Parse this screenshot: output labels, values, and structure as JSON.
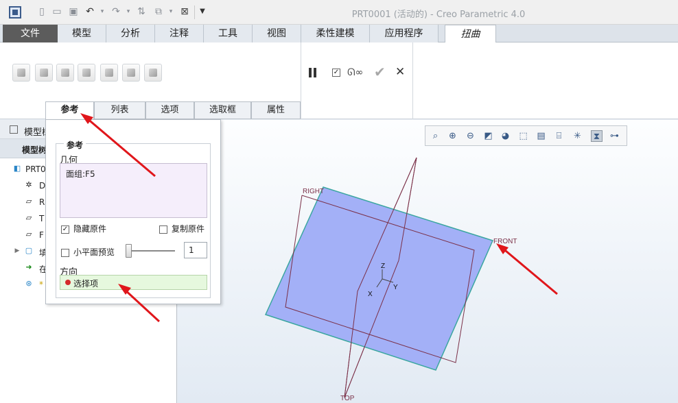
{
  "window": {
    "title": "PRT0001 (活动的) - Creo Parametric 4.0",
    "quick_access": [
      "new-icon",
      "open-icon",
      "save-icon",
      "undo-icon",
      "redo-icon",
      "regenerate-icon",
      "windows-icon",
      "close-window-icon",
      "customize-icon"
    ]
  },
  "ribbon_tabs": [
    "文件",
    "模型",
    "分析",
    "注释",
    "工具",
    "视图",
    "柔性建模",
    "应用程序",
    "扭曲"
  ],
  "toolbar": {
    "tools": [
      "transform-tool",
      "warp-tool",
      "spine-tool",
      "stretch-tool",
      "bend-tool",
      "twist-tool",
      "sculpt-tool"
    ],
    "controls": [
      "pause-icon",
      "preview-checkbox",
      "glasses-icon",
      "ok-icon",
      "cancel-icon"
    ]
  },
  "sub_tabs": [
    "参考",
    "列表",
    "选项",
    "选取框",
    "属性"
  ],
  "reference_panel": {
    "group_title": "参考",
    "geometry_label": "几何",
    "geometry_items": [
      "面组:F5"
    ],
    "hide_original_label": "隐藏原件",
    "hide_original_checked": true,
    "copy_original_label": "复制原件",
    "copy_original_checked": false,
    "small_plane_preview_label": "小平面预览",
    "small_plane_preview_checked": false,
    "preview_value": "1",
    "direction_label": "方向",
    "direction_item": "选择项"
  },
  "model_tree": {
    "header": "模型树",
    "sub_header": "模型树",
    "items": [
      {
        "icon": "part-icon",
        "label": "PRT0"
      },
      {
        "icon": "csys-icon",
        "label": "D"
      },
      {
        "icon": "datum-plane-icon",
        "label": "R"
      },
      {
        "icon": "datum-plane-icon",
        "label": "T"
      },
      {
        "icon": "datum-plane-icon",
        "label": "F"
      },
      {
        "icon": "fill-icon",
        "label": "填"
      },
      {
        "icon": "insert-arrow-icon",
        "label": "在"
      },
      {
        "icon": "warp-feature-icon",
        "label": "*"
      }
    ]
  },
  "graphics": {
    "view_tools": [
      "refit-icon",
      "zoom-in-icon",
      "zoom-out-icon",
      "repaint-icon",
      "display-style-icon",
      "saved-views-icon",
      "view-manager-icon",
      "perspective-icon",
      "datum-display-icon",
      "annotation-icon",
      "spin-center-icon"
    ],
    "labels": {
      "right": "RIGHT",
      "front": "FRONT",
      "top": "TOP",
      "z": "Z",
      "x": "X",
      "y": "Y"
    },
    "colors": {
      "surface_fill": "#a3b0f7",
      "surface_edge": "#3aa6a0",
      "datum_plane": "#7a2f47",
      "annotation_arrow": "#e0161b"
    }
  }
}
